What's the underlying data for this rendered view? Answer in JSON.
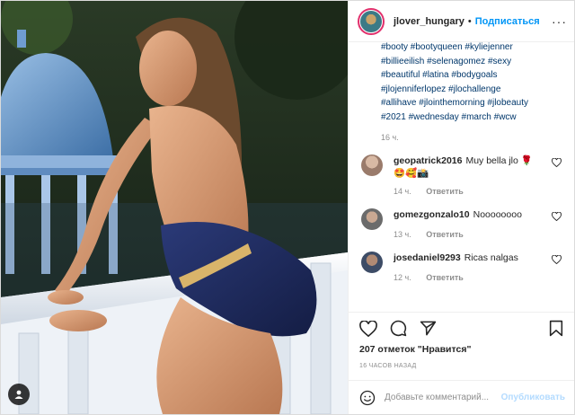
{
  "header": {
    "username": "jlover_hungary",
    "dot": "•",
    "follow_label": "Подписаться",
    "more_label": "···"
  },
  "caption": {
    "lines": [
      "#booty #bootyqueen #kyliejenner",
      "#billieeilish #selenagomez #sexy",
      "#beautiful #latina #bodygoals",
      "#jlojenniferlopez #jlochallenge",
      "#allihave #jlointhemorning #jlobeauty",
      "#2021 #wednesday #march #wcw"
    ],
    "time": "16 ч."
  },
  "comments": [
    {
      "user": "geopatrick2016",
      "text": "Muy bella jlo 🌹",
      "extra": "🤩🥰📸",
      "time": "14 ч.",
      "reply": "Ответить",
      "avatar_color": "#9a7b6b"
    },
    {
      "user": "gomezgonzalo10",
      "text": "Noooooooo",
      "extra": "",
      "time": "13 ч.",
      "reply": "Ответить",
      "avatar_color": "#6b6b6b"
    },
    {
      "user": "josedaniel9293",
      "text": "Ricas nalgas",
      "extra": "",
      "time": "12 ч.",
      "reply": "Ответить",
      "avatar_color": "#3d4c66"
    }
  ],
  "actions": {
    "icons": [
      "heart-icon",
      "comment-icon",
      "share-icon",
      "bookmark-icon"
    ]
  },
  "likes_text": "207 отметок \"Нравится\"",
  "post_time": "16 ЧАСОВ НАЗАД",
  "add_comment": {
    "placeholder": "Добавьте комментарий...",
    "publish_label": "Опубликовать"
  },
  "colors": {
    "accent": "#0095f6",
    "publish_disabled": "#b3dbff",
    "hashtag": "#00376b",
    "meta": "#8e8e8e"
  }
}
